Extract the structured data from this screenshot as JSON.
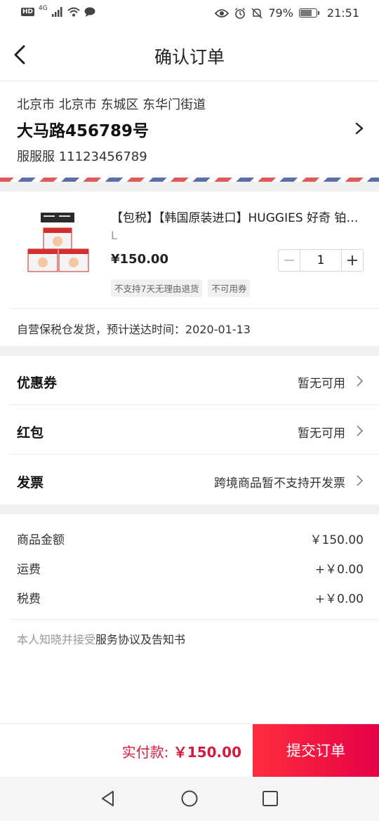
{
  "status_bar": {
    "network": "4G",
    "battery_percent_text": "79%",
    "battery_level": 0.79,
    "time": "21:51"
  },
  "nav": {
    "title": "确认订单"
  },
  "address": {
    "region": "北京市 北京市 东城区 东华门街道",
    "street": "大马路456789号",
    "contact": "服服服 11123456789"
  },
  "product": {
    "title": "【包税】【韩国原装进口】HUGGIES 好奇 铂金装纸尿裤 L",
    "spec": "L",
    "price": "¥150.00",
    "quantity": "1",
    "tags": [
      "不支持7天无理由退货",
      "不可用券"
    ],
    "delivery": "自营保税仓发货，预计送达时间：2020-01-13"
  },
  "options": [
    {
      "label": "优惠券",
      "value": "暂无可用"
    },
    {
      "label": "红包",
      "value": "暂无可用"
    },
    {
      "label": "发票",
      "value": "跨境商品暂不支持开发票"
    }
  ],
  "summary": [
    {
      "label": "商品金额",
      "value": "￥150.00"
    },
    {
      "label": "运费",
      "value": "+￥0.00"
    },
    {
      "label": "税费",
      "value": "+￥0.00"
    }
  ],
  "agreement": {
    "prefix": "本人知晓并接受",
    "link": "服务协议及告知书"
  },
  "bottom_bar": {
    "pay_label": "实付款:",
    "pay_amount": "￥150.00",
    "submit_label": "提交订单"
  },
  "colors": {
    "accent": "#e60048",
    "price_red": "#d61a3c"
  },
  "icons": [
    "hd-icon",
    "signal-icon",
    "wifi-icon",
    "message-icon",
    "eye-icon",
    "alarm-icon",
    "mute-icon",
    "battery-icon",
    "back-arrow-icon",
    "chevron-right-icon",
    "minus-icon",
    "plus-icon",
    "back-triangle-icon",
    "home-circle-icon",
    "recent-square-icon"
  ]
}
